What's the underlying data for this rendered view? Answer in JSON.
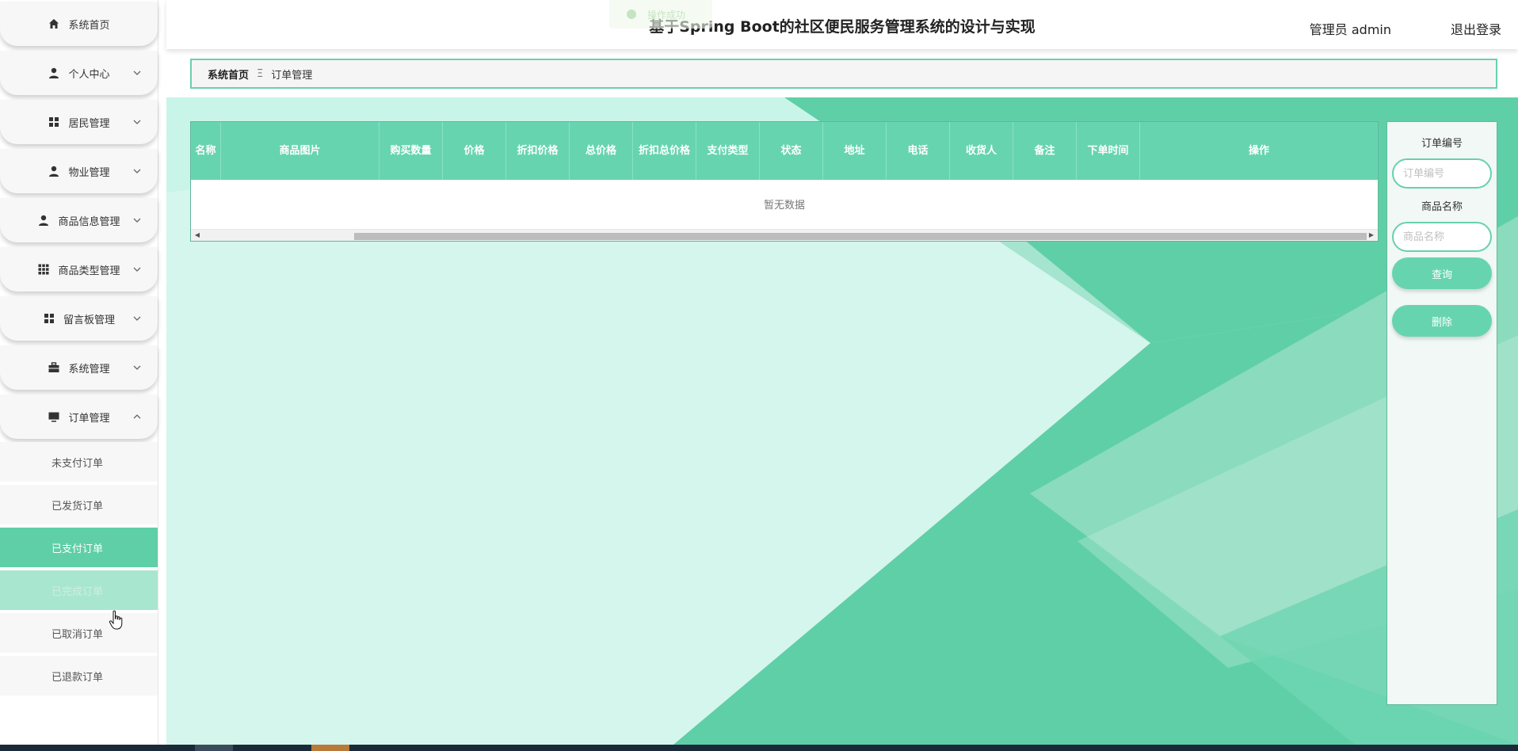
{
  "header": {
    "title": "基于Spring Boot的社区便民服务管理系统的设计与实现",
    "user": "管理员 admin",
    "logout": "退出登录",
    "toast": "操作成功"
  },
  "sidebar": {
    "items": [
      {
        "label": "系统首页",
        "icon": "home-icon"
      },
      {
        "label": "个人中心",
        "icon": "user-icon"
      },
      {
        "label": "居民管理",
        "icon": "grid-icon"
      },
      {
        "label": "物业管理",
        "icon": "user-icon"
      },
      {
        "label": "商品信息管理",
        "icon": "user-icon"
      },
      {
        "label": "商品类型管理",
        "icon": "grid9-icon"
      },
      {
        "label": "留言板管理",
        "icon": "grid-icon"
      },
      {
        "label": "系统管理",
        "icon": "briefcase-icon"
      },
      {
        "label": "订单管理",
        "icon": "monitor-icon"
      }
    ],
    "subitems": [
      {
        "label": "未支付订单"
      },
      {
        "label": "已发货订单"
      },
      {
        "label": "已支付订单"
      },
      {
        "label": "已完成订单"
      },
      {
        "label": "已取消订单"
      },
      {
        "label": "已退款订单"
      }
    ]
  },
  "breadcrumb": {
    "home": "系统首页",
    "sep": "Ξ",
    "current": "订单管理"
  },
  "table": {
    "columns": [
      "名称",
      "商品图片",
      "购买数量",
      "价格",
      "折扣价格",
      "总价格",
      "折扣总价格",
      "支付类型",
      "状态",
      "地址",
      "电话",
      "收货人",
      "备注",
      "下单时间",
      "操作"
    ],
    "empty": "暂无数据"
  },
  "search": {
    "order_label": "订单编号",
    "order_placeholder": "订单编号",
    "product_label": "商品名称",
    "product_placeholder": "商品名称",
    "query": "查询",
    "delete": "删除"
  },
  "colors": {
    "accent": "#67d4b0",
    "active": "#5fcfa8"
  }
}
